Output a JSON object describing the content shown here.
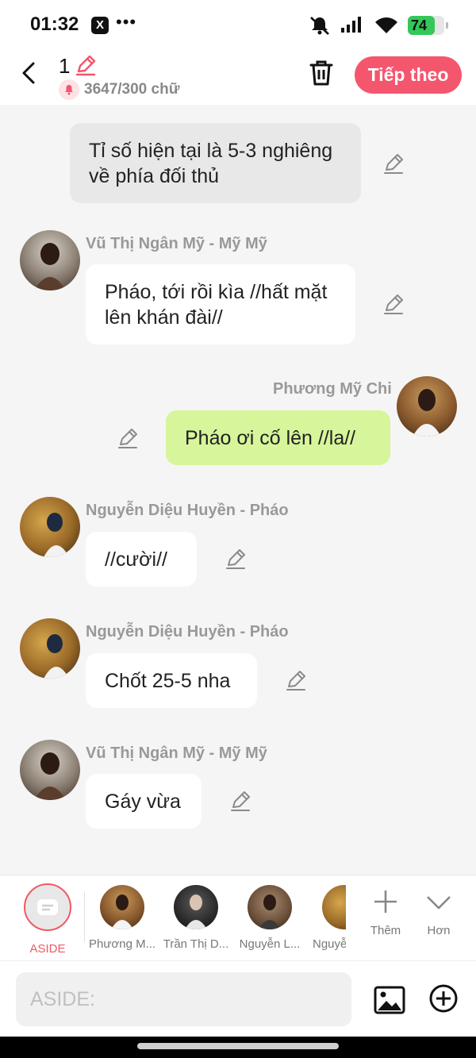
{
  "status_bar": {
    "time": "01:32",
    "x_app": "X",
    "more": "•••",
    "battery": "74",
    "battery_fraction": 0.74,
    "icons": [
      "mute-icon",
      "signal-icon",
      "wifi-icon",
      "battery-icon"
    ]
  },
  "header": {
    "scene_number": "1",
    "char_count": "3647/300 chữ",
    "next_label": "Tiếp theo",
    "accent_color": "#f4566e"
  },
  "messages": [
    {
      "type": "narration",
      "text": "Tỉ số hiện tại là 5-3 nghiêng về phía đối thủ"
    },
    {
      "type": "left",
      "sender": "Vũ Thị Ngân Mỹ - Mỹ Mỹ",
      "text": "Pháo, tới rồi kìa //hất mặt lên khán đài//"
    },
    {
      "type": "right",
      "sender": "Phương Mỹ Chi",
      "text": "Pháo ơi cố lên //la//"
    },
    {
      "type": "left",
      "sender": "Nguyễn Diệu Huyền - Pháo",
      "text": "//cười//"
    },
    {
      "type": "left",
      "sender": "Nguyễn Diệu Huyền - Pháo",
      "text": "Chốt 25-5 nha"
    },
    {
      "type": "left",
      "sender": "Vũ Thị Ngân Mỹ - Mỹ Mỹ",
      "text": "Gáy vừa"
    }
  ],
  "characters": {
    "aside_label": "ASIDE",
    "items": [
      "Phương M...",
      "Trần Thị D...",
      "Nguyễn L...",
      "Nguyễ"
    ],
    "add_label": "Thêm",
    "more_label": "Hơn"
  },
  "input": {
    "placeholder": "ASIDE:"
  }
}
